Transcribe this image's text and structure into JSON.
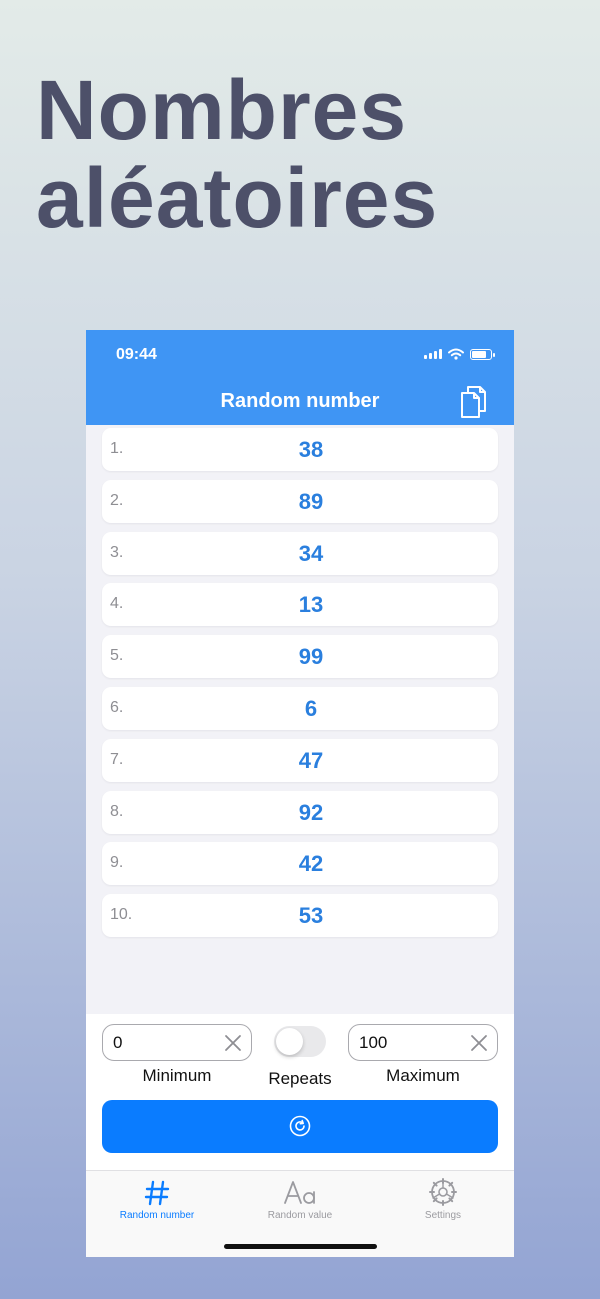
{
  "promo": {
    "line1": "Nombres",
    "line2": "aléatoires"
  },
  "status_bar": {
    "time": "09:44"
  },
  "nav": {
    "title": "Random number",
    "copy_icon": "copy-icon"
  },
  "results": [
    {
      "index": "1.",
      "value": "38"
    },
    {
      "index": "2.",
      "value": "89"
    },
    {
      "index": "3.",
      "value": "34"
    },
    {
      "index": "4.",
      "value": "13"
    },
    {
      "index": "5.",
      "value": "99"
    },
    {
      "index": "6.",
      "value": "6"
    },
    {
      "index": "7.",
      "value": "47"
    },
    {
      "index": "8.",
      "value": "92"
    },
    {
      "index": "9.",
      "value": "42"
    },
    {
      "index": "10.",
      "value": "53"
    }
  ],
  "controls": {
    "minimum": {
      "value": "0",
      "label": "Minimum"
    },
    "maximum": {
      "value": "100",
      "label": "Maximum"
    },
    "repeats": {
      "label": "Repeats",
      "on": false
    },
    "generate_icon": "refresh-icon"
  },
  "tabs": [
    {
      "label": "Random number",
      "icon": "hash-icon",
      "active": true
    },
    {
      "label": "Random value",
      "icon": "text-aa-icon",
      "active": false
    },
    {
      "label": "Settings",
      "icon": "gear-icon",
      "active": false
    }
  ],
  "colors": {
    "accent": "#0a7cff",
    "header": "#3f95f4",
    "value_text": "#2a7fde"
  }
}
